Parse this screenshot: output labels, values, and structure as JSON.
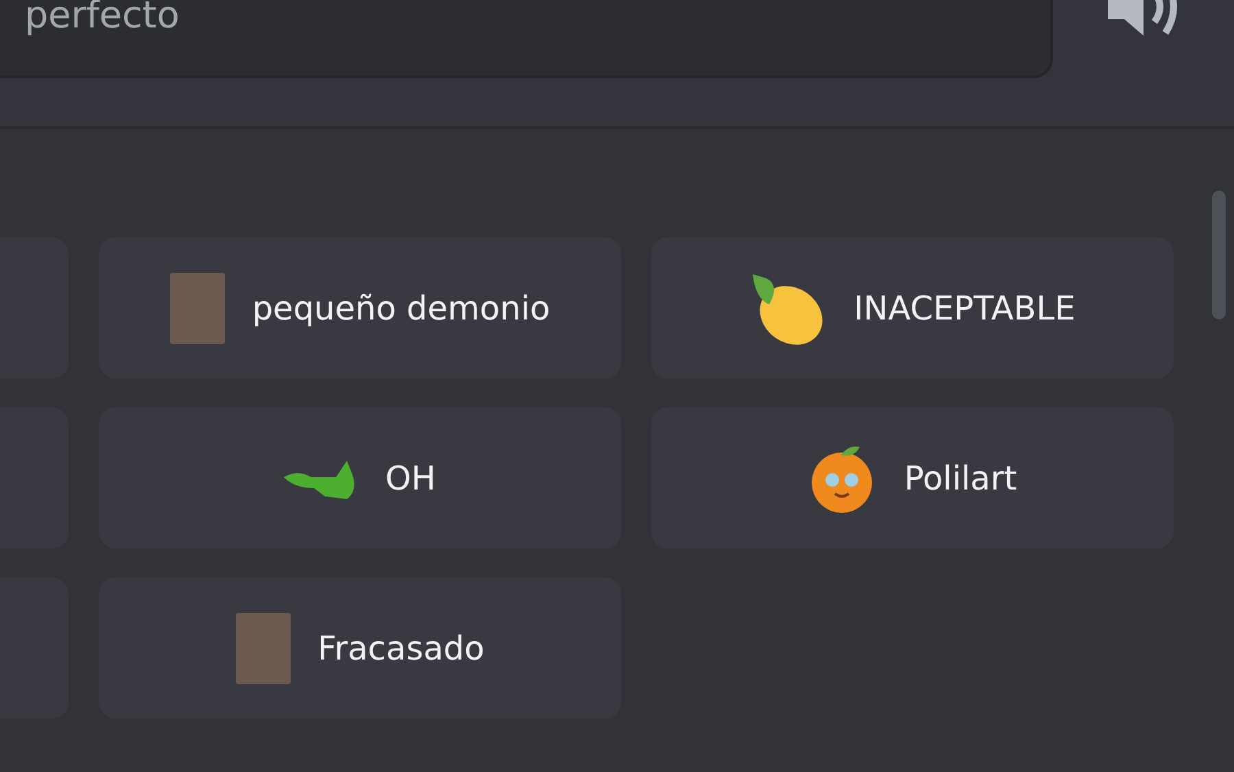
{
  "search": {
    "value": "perfecto"
  },
  "sound_rows": [
    [
      {
        "label": "pequeño demonio",
        "kind": "photo"
      },
      {
        "label": "INACEPTABLE",
        "kind": "lemon"
      }
    ],
    [
      {
        "label": "OH",
        "kind": "crocodile"
      },
      {
        "label": "Polilart",
        "kind": "fruit"
      }
    ],
    [
      {
        "label": "Fracasado",
        "kind": "photo"
      }
    ]
  ]
}
